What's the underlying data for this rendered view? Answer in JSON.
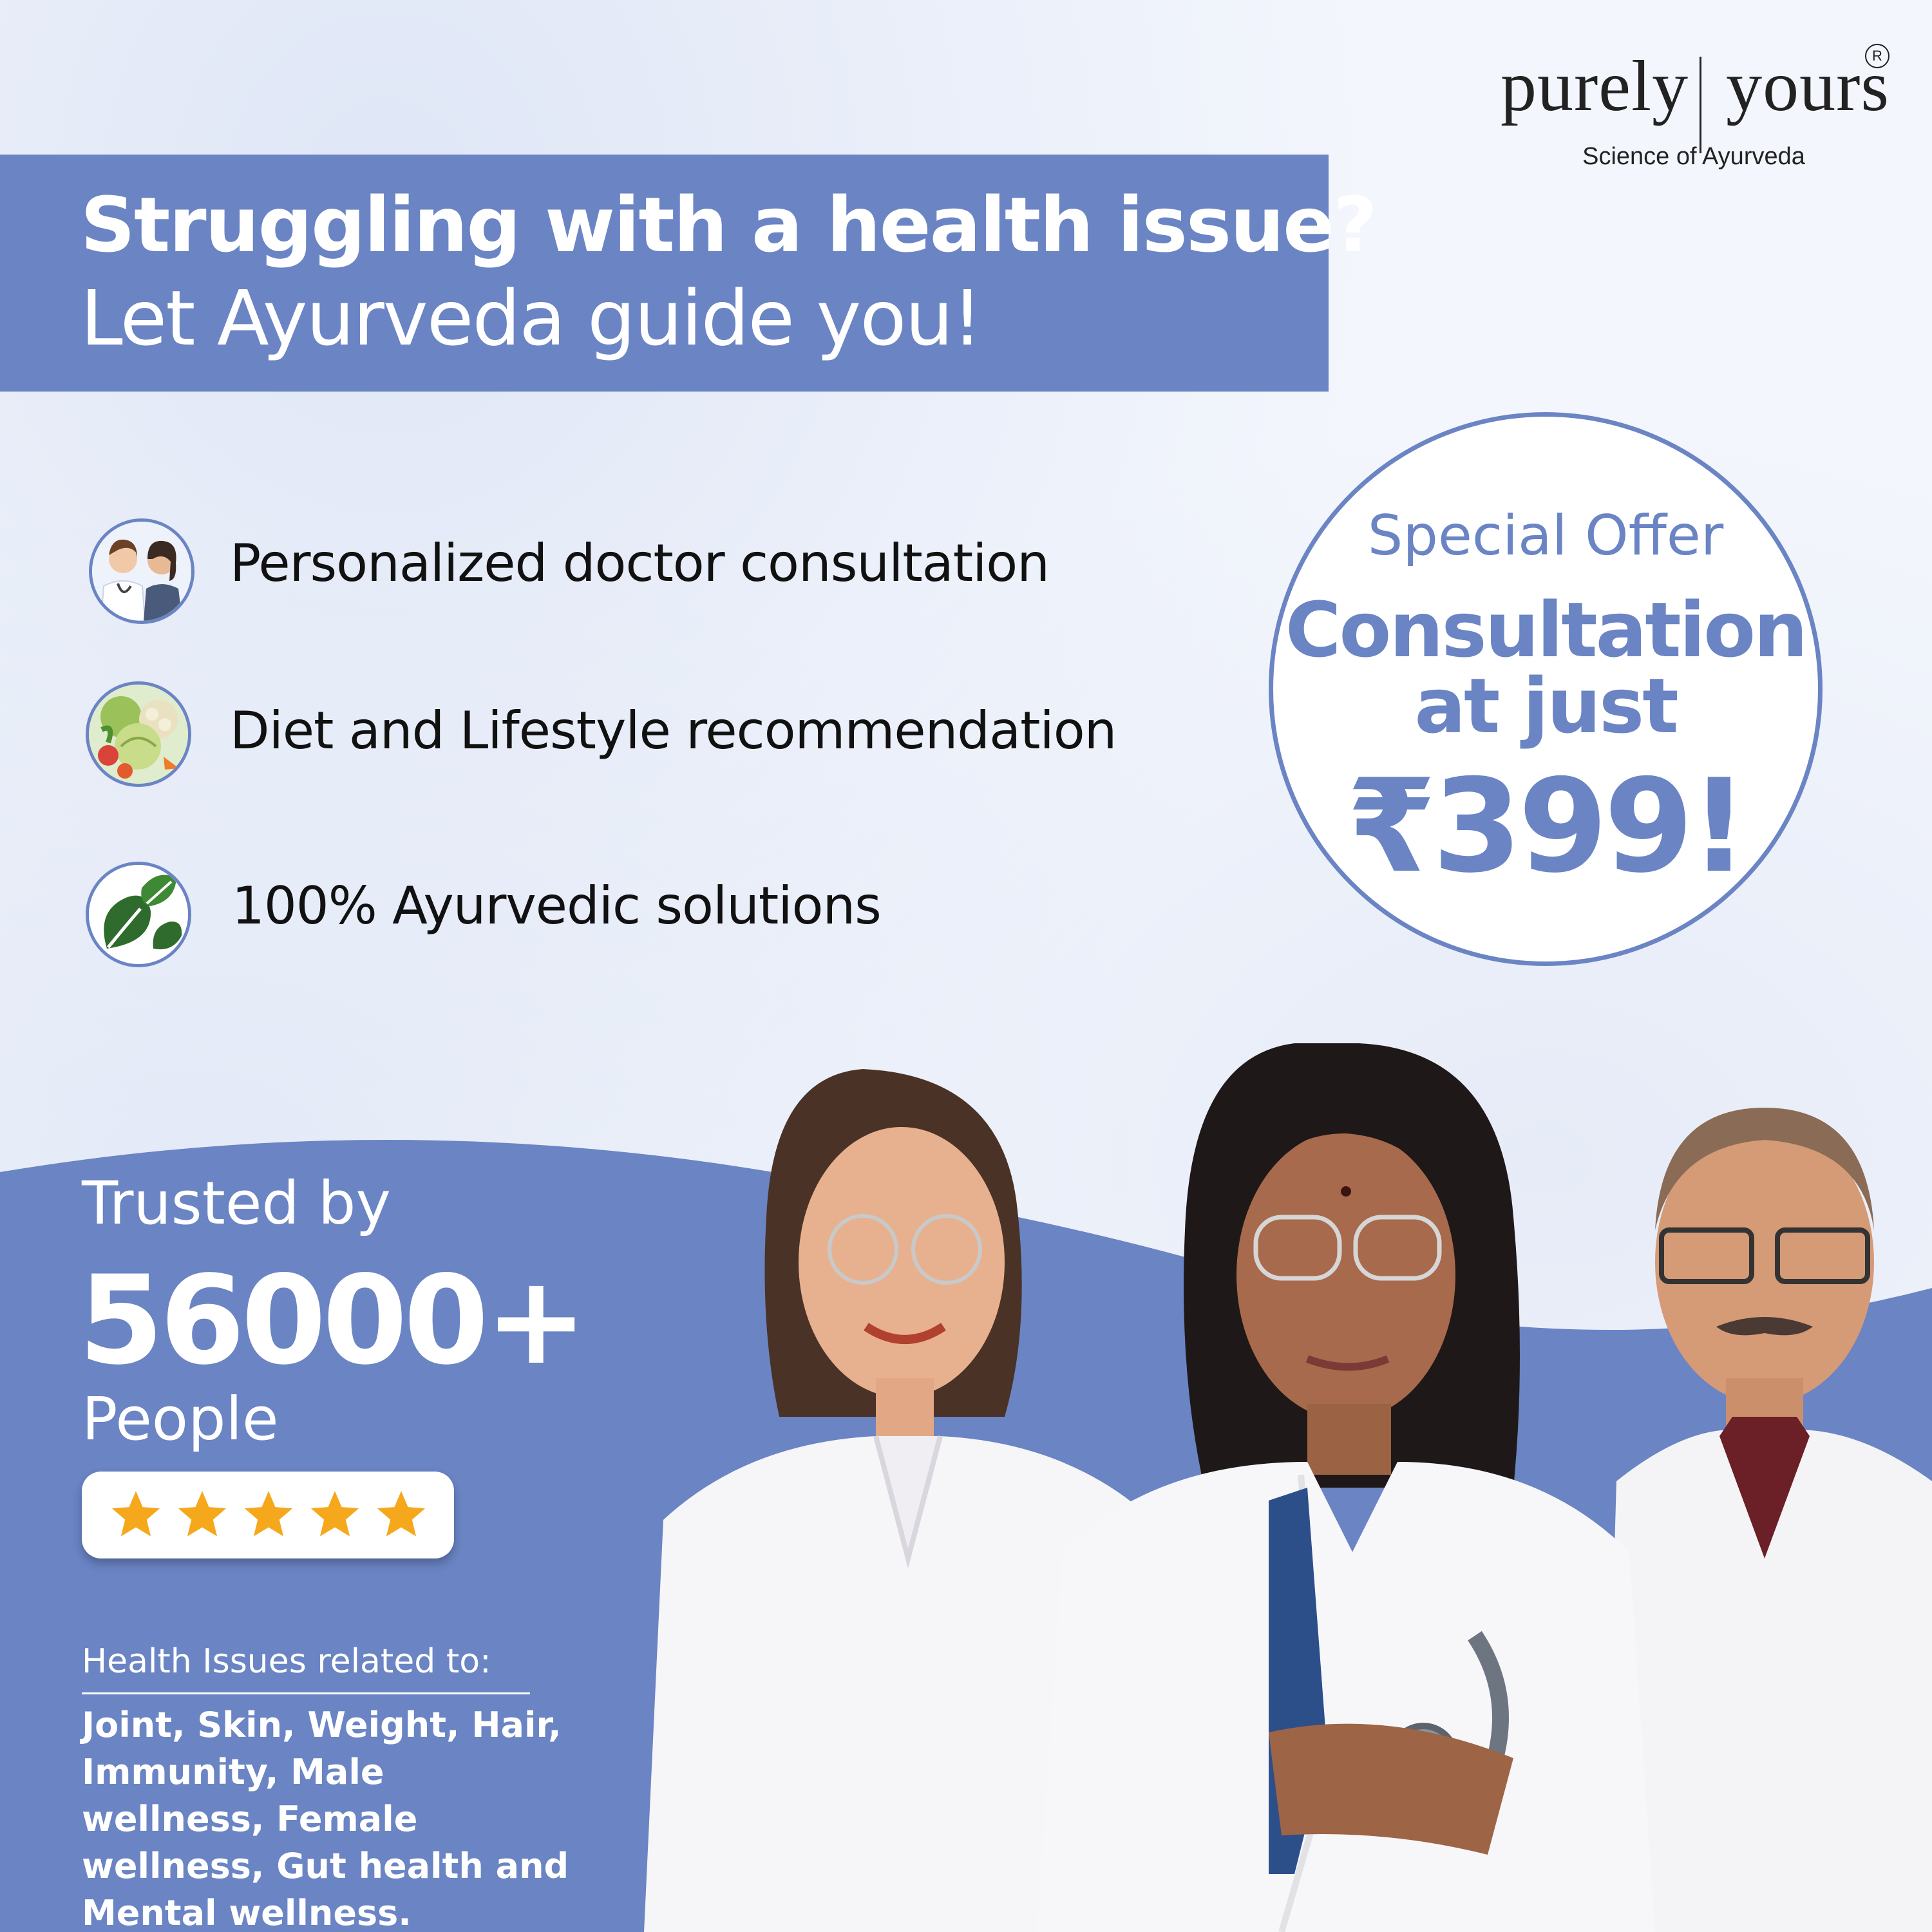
{
  "brand": {
    "name": "purely yours",
    "name_left": "purely",
    "name_right": "yours",
    "registered_mark": "R",
    "tagline": "Science of Ayurveda"
  },
  "headline": {
    "line1": "Struggling with a health issue?",
    "line2": "Let Ayurveda guide you!"
  },
  "features": [
    {
      "icon": "doctor-consultation-icon",
      "label": "Personalized doctor consultation"
    },
    {
      "icon": "vegetables-icon",
      "label": "Diet and Lifestyle recommendation"
    },
    {
      "icon": "leaves-icon",
      "label": "100% Ayurvedic solutions"
    }
  ],
  "offer": {
    "line1": "Special Offer",
    "line2": "Consultation",
    "line3": "at just",
    "price": "₹399!"
  },
  "trust": {
    "label": "Trusted by",
    "count": "56000+",
    "unit": "People",
    "rating_stars": 5
  },
  "issues": {
    "label": "Health Issues related to:",
    "text": "Joint, Skin, Weight, Hair, Immunity, Male wellness, Female wellness, Gut health and Mental wellness."
  },
  "colors": {
    "accent": "#6a84c4",
    "star": "#f5a81c",
    "text_dark": "#111111",
    "white": "#ffffff"
  }
}
